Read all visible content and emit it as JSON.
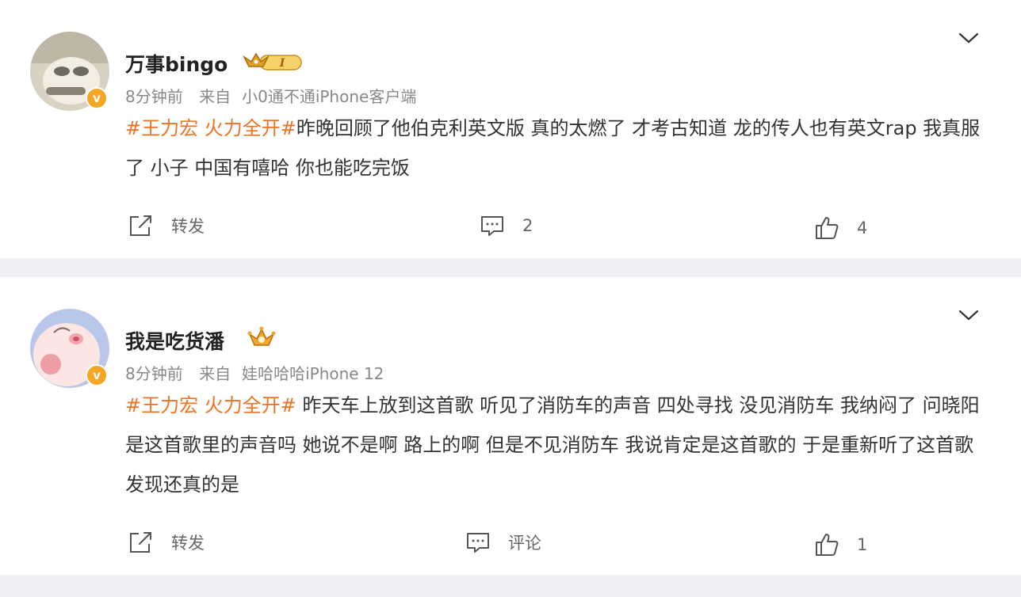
{
  "posts": [
    {
      "username": "万事bingo",
      "badge_level": "I",
      "time": "8分钟前",
      "from_label": "来自",
      "source": "小0通不通iPhone客户端",
      "tags": "#王力宏 火力全开#",
      "text": "昨晚回顾了他伯克利英文版 真的太燃了 才考古知道 龙的传人也有英文rap 我真服了 小子 中国有嘻哈 你也能吃完饭",
      "actions": {
        "repost": "转发",
        "comment": "2",
        "like": "4"
      }
    },
    {
      "username": "我是吃货潘",
      "time": "8分钟前",
      "from_label": "来自",
      "source": "娃哈哈哈iPhone 12",
      "tags": "#王力宏 火力全开#",
      "text": " 昨天车上放到这首歌 听见了消防车的声音 四处寻找 没见消防车 我纳闷了 问晓阳是这首歌里的声音吗 她说不是啊 路上的啊 但是不见消防车 我说肯定是这首歌的 于是重新听了这首歌 发现还真的是",
      "actions": {
        "repost": "转发",
        "comment": "评论",
        "like": "1"
      }
    }
  ],
  "icons": {
    "repost": "share-arrow-icon",
    "comment": "comment-bubble-icon",
    "like": "thumbs-up-icon",
    "menu": "chevron-down-icon",
    "verified": "verified-v-icon"
  },
  "colors": {
    "tag": "#f07223",
    "verified": "#f5a623",
    "meta": "#888888"
  }
}
